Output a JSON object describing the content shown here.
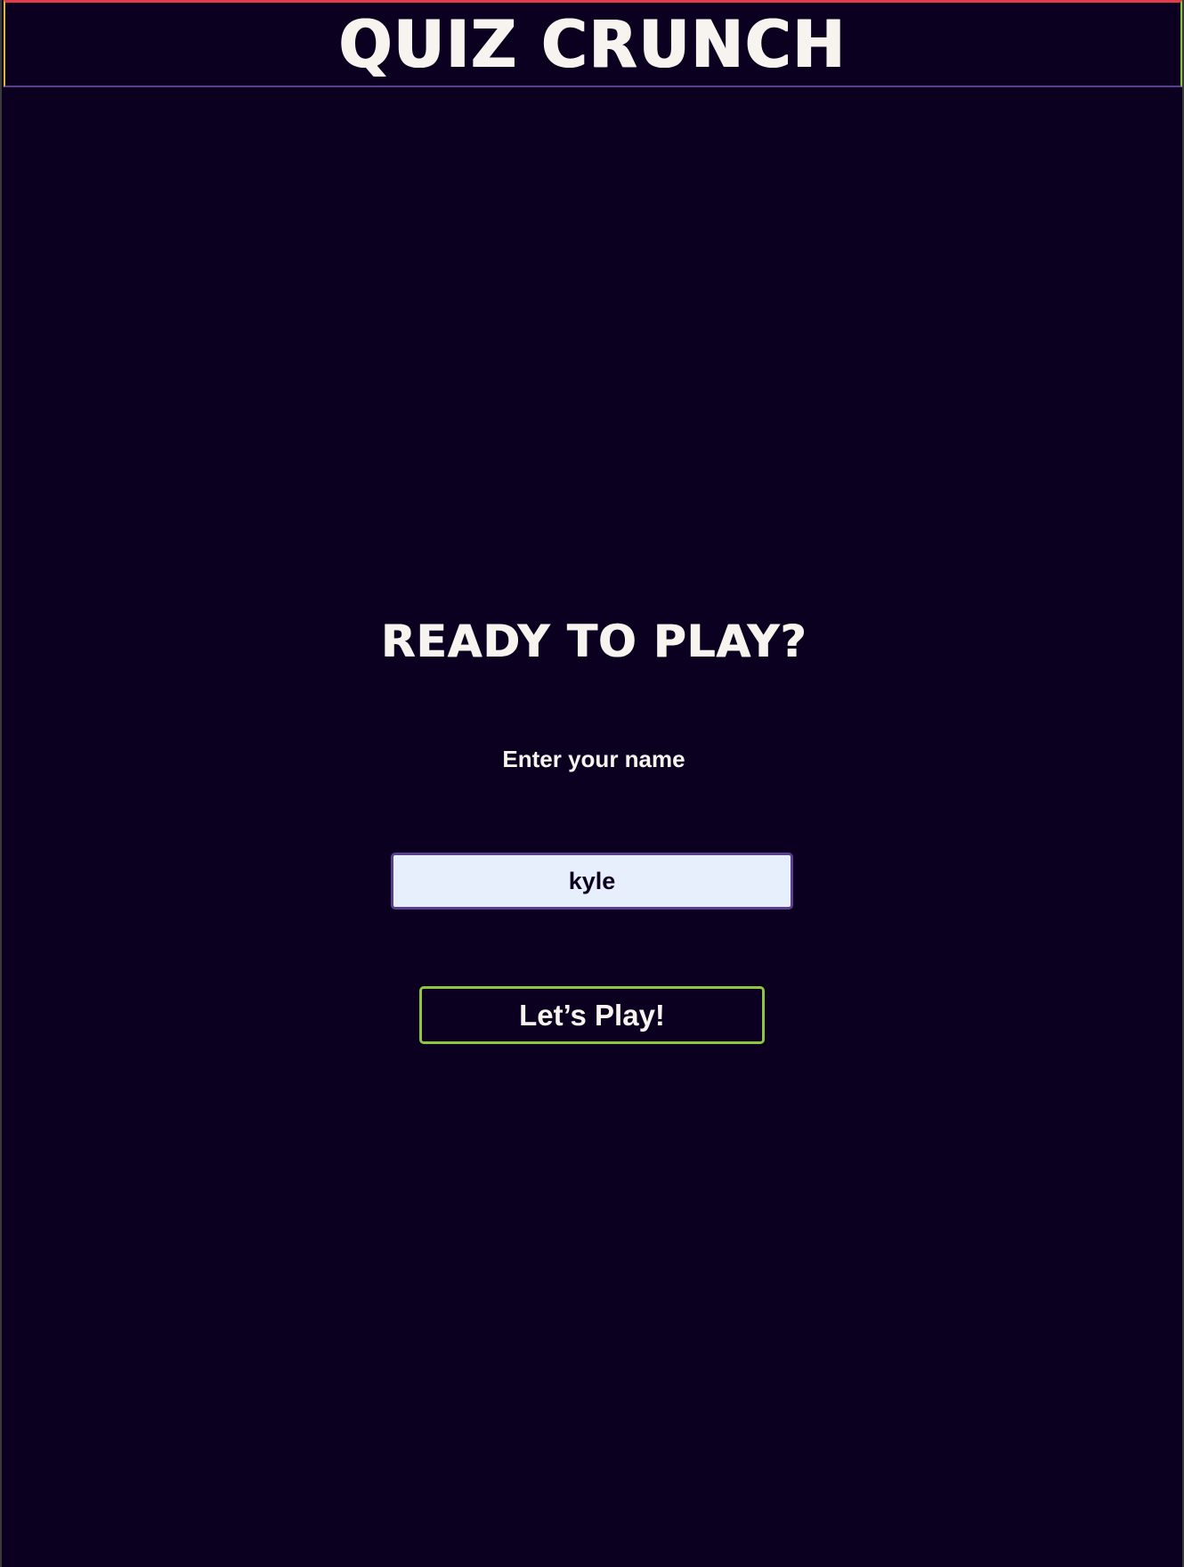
{
  "header": {
    "title": "QUIZ CRUNCH"
  },
  "main": {
    "heading": "READY TO PLAY?",
    "name_label": "Enter your name",
    "name_value": "kyle",
    "play_button_label": "Let’s Play!"
  },
  "colors": {
    "background": "#0b0020",
    "text": "#f7f4ef",
    "input_background": "#e8effc",
    "input_border": "#5a3f8c",
    "button_border": "#8ec63f",
    "header_top_border": "#e23b4a"
  }
}
